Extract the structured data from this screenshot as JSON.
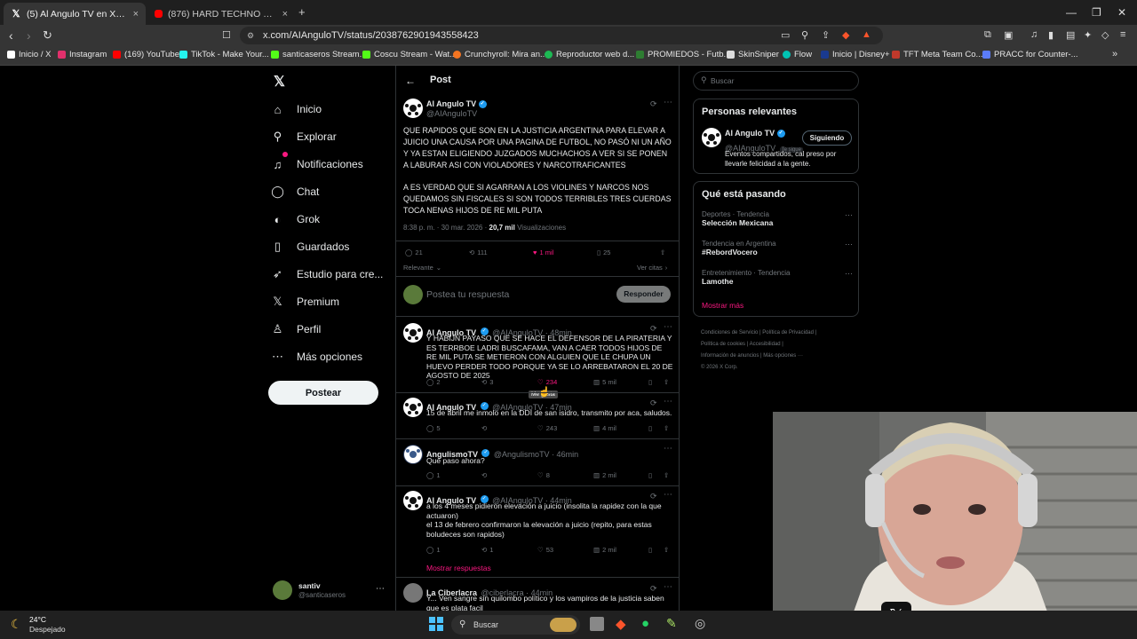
{
  "browser": {
    "tabs": [
      {
        "title": "(5) Al Angulo TV en X: \"QUE RAPID",
        "close": "×"
      },
      {
        "title": "(876) HARD TECHNO ◉ willi.iam - Sc",
        "close": "×"
      }
    ],
    "new_tab": "+",
    "url": "x.com/AIAnguloTV/status/2038762901943558423",
    "bookmarks": [
      {
        "label": "Inicio / X",
        "color": "#ffffff"
      },
      {
        "label": "Instagram",
        "color": "#e1306c"
      },
      {
        "label": "(169) YouTube",
        "color": "#ff0000"
      },
      {
        "label": "TikTok - Make Your...",
        "color": "#25f4ee"
      },
      {
        "label": "santicaseros Stream...",
        "color": "#53fc18"
      },
      {
        "label": "Coscu Stream - Wat...",
        "color": "#53fc18"
      },
      {
        "label": "Crunchyroll: Mira an...",
        "color": "#f47521"
      },
      {
        "label": "Reproductor web d...",
        "color": "#1db954"
      },
      {
        "label": "PROMIEDOS - Futb...",
        "color": "#2e7d32"
      },
      {
        "label": "SkinSniper",
        "color": "#dddddd"
      },
      {
        "label": "Flow",
        "color": "#00c4b4"
      },
      {
        "label": "Inicio | Disney+",
        "color": "#1a3a8f"
      },
      {
        "label": "TFT Meta Team Co...",
        "color": "#c0392b"
      },
      {
        "label": "PRACC for Counter-...",
        "color": "#5b7cfa"
      }
    ]
  },
  "sidebar": {
    "items": [
      {
        "label": "Inicio",
        "icon": "home-icon"
      },
      {
        "label": "Explorar",
        "icon": "search-icon"
      },
      {
        "label": "Notificaciones",
        "icon": "bell-icon"
      },
      {
        "label": "Chat",
        "icon": "chat-icon"
      },
      {
        "label": "Grok",
        "icon": "grok-icon"
      },
      {
        "label": "Guardados",
        "icon": "bookmark-icon"
      },
      {
        "label": "Estudio para cre...",
        "icon": "rocket-icon"
      },
      {
        "label": "Premium",
        "icon": "x-icon"
      },
      {
        "label": "Perfil",
        "icon": "person-icon"
      },
      {
        "label": "Más opciones",
        "icon": "more-icon"
      }
    ],
    "post_button": "Postear",
    "account": {
      "name": "santiv",
      "handle": "@santicaseros"
    }
  },
  "header": {
    "title": "Post"
  },
  "main_post": {
    "name": "Al Angulo TV",
    "handle": "@AIAnguloTV",
    "text1": "QUE RAPIDOS QUE SON EN LA JUSTICIA ARGENTINA PARA ELEVAR A JUICIO UNA CAUSA POR UNA PAGINA DE FUTBOL, NO PASÓ NI UN AÑO Y YA ESTAN ELIGIENDO JUZGADOS MUCHACHOS A VER SI SE PONEN A LABURAR ASI CON VIOLADORES Y NARCOTRAFICANTES",
    "text2": "A ES VERDAD QUE SI AGARRAN A LOS VIOLINES Y NARCOS NOS QUEDAMOS SIN FISCALES SI SON TODOS TERRIBLES TRES CUERDAS TOCA NENAS HIJOS DE RE MIL PUTA",
    "time": "8:38 p. m. · 30 mar. 2026 ·",
    "views": "20,7 mil",
    "views_label": "Visualizaciones",
    "replies": "21",
    "reposts": "111",
    "likes": "1 mil",
    "bookmarks": "25",
    "sort": "Relevante",
    "quotes": "Ver citas"
  },
  "composer": {
    "placeholder": "Postea tu respuesta",
    "button": "Responder"
  },
  "replies": [
    {
      "name": "Al Angulo TV",
      "handle": "@AIAnguloTV · 48min",
      "text": "Y HABIJN PAYASO QUE SE HACE EL DEFENSOR DE LA PIRATERIA Y ES TERRBOE LADRI BUSCAFAMA, VAN A CAER TODOS HIJOS DE RE MIL PUTA SE METIERON CON ALGUIEN QUE LE CHUPA UN HUEVO PERDER TODO PORQUE YA SE LO ARREBATARON EL 20 DE AGOSTO DE 2025",
      "replies": "2",
      "reposts": "3",
      "likes": "234",
      "views": "5 mil"
    },
    {
      "name": "Al Angulo TV",
      "handle": "@AIAnguloTV · 47min",
      "text": "15 de abril me inmolo en la DDI de san isidro, transmito por aca, saludos.",
      "replies": "5",
      "reposts": "",
      "likes": "243",
      "views": "4 mil"
    },
    {
      "name": "AngulismoTV",
      "handle": "@AngulismoTV · 46min",
      "text": "Que paso ahora?",
      "replies": "1",
      "reposts": "",
      "likes": "8",
      "views": "2 mil"
    },
    {
      "name": "Al Angulo TV",
      "handle": "@AIAnguloTV · 44min",
      "text": "a los 4 meses pidieron elevación a juicio (insolita la rapidez con la que actuaron)\nel 13 de febrero confirmaron la elevación a juicio (repito, para estas boludeces son rapidos)",
      "replies": "1",
      "reposts": "1",
      "likes": "53",
      "views": "2 mil"
    },
    {
      "name": "La Ciberlacra",
      "handle": "@ciberlacra · 44min",
      "text": "Y... Ven sangre sin quilombo político y los vampiros de la justicia saben que es plata facil",
      "replies": "",
      "reposts": "",
      "likes": "",
      "views": ""
    }
  ],
  "tooltip": "Me gusta",
  "show_replies": "Mostrar respuestas",
  "right": {
    "search_placeholder": "Buscar",
    "relevant_title": "Personas relevantes",
    "relevant": {
      "name": "Al Angulo TV",
      "handle": "@AIAnguloTV",
      "follows_you": "Te sigue",
      "button": "Siguiendo",
      "bio": "Eventos compartidos, cal preso por llevarle felicidad a la gente."
    },
    "trends_title": "Qué está pasando",
    "trends": [
      {
        "meta": "Deportes · Tendencia",
        "name": "Selección Mexicana"
      },
      {
        "meta": "Tendencia en Argentina",
        "name": "#RebordVocero"
      },
      {
        "meta": "Entretenimiento · Tendencia",
        "name": "Lamothe"
      }
    ],
    "show_more": "Mostrar más",
    "footer": [
      "Condiciones de Servicio",
      "Política de Privacidad",
      "Política de cookies",
      "Accesibilidad",
      "Información de anuncios",
      "Más opciones ···",
      "© 2026 X Corp."
    ]
  },
  "taskbar": {
    "temp": "24°C",
    "weather": "Despejado",
    "search": "Buscar"
  },
  "colors": {
    "accent": "#1d9bf0",
    "like": "#f91880",
    "brave": "#fb542b"
  }
}
